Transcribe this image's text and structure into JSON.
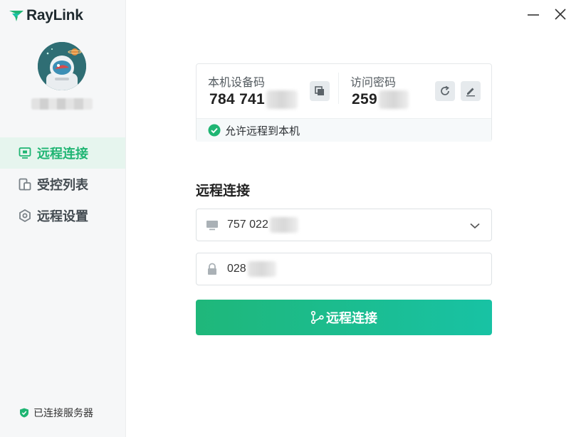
{
  "app": {
    "logo_text": "RayLink",
    "brand_color": "#1fb573"
  },
  "sidebar": {
    "items": [
      {
        "label": "远程连接",
        "icon": "monitor-icon",
        "active": true
      },
      {
        "label": "受控列表",
        "icon": "devices-icon",
        "active": false
      },
      {
        "label": "远程设置",
        "icon": "settings-hexagon-icon",
        "active": false
      }
    ],
    "server_status": "已连接服务器"
  },
  "device": {
    "code_label": "本机设备码",
    "code_value": "784 741",
    "password_label": "访问密码",
    "password_value": "259",
    "allow_remote": "允许远程到本机"
  },
  "connect": {
    "title": "远程连接",
    "device_input_value": "757 022",
    "password_input_value": "028",
    "button_label": "远程连接"
  }
}
